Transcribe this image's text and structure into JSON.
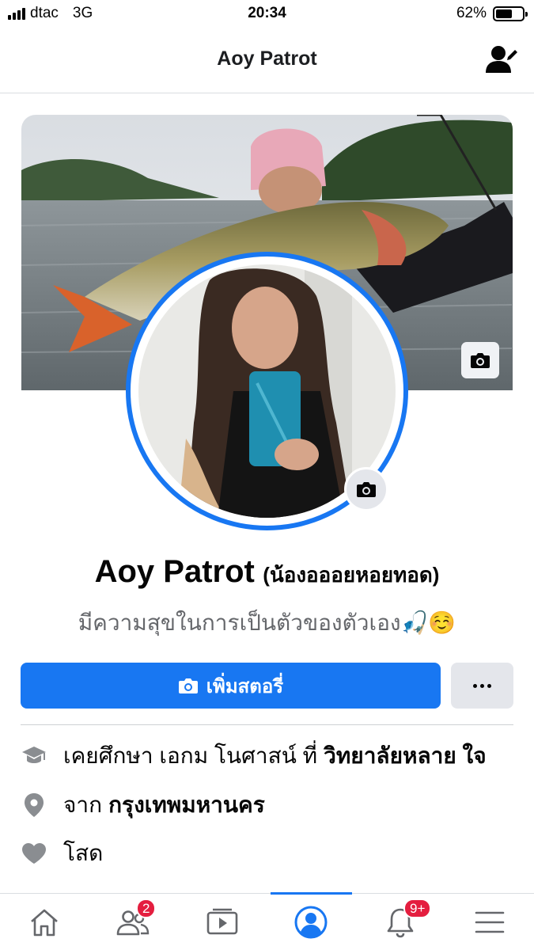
{
  "status_bar": {
    "carrier": "dtac",
    "network": "3G",
    "time": "20:34",
    "battery_percent": "62%",
    "battery_level": 0.62
  },
  "header": {
    "title": "Aoy Patrot",
    "edit_icon": "edit-profile-icon"
  },
  "profile": {
    "name": "Aoy Patrot",
    "nickname": "(น้องอออยหอยทอด)",
    "bio": "มีความสุขในการเป็นตัวของตัวเอง🎣☺️"
  },
  "actions": {
    "add_story_label": "เพิ่มสตอรี่",
    "more_icon": "more-dots-icon"
  },
  "details": [
    {
      "icon": "graduation-cap-icon",
      "text": "เคยศึกษา เอกม โนศาสน์ ที่",
      "bold": "วิทยาลัยหลาย ใจ"
    },
    {
      "icon": "location-pin-icon",
      "text": "จาก",
      "bold": "กรุงเทพมหานคร"
    },
    {
      "icon": "heart-icon",
      "text": "โสด",
      "bold": ""
    }
  ],
  "tabbar": {
    "active": "profile",
    "friends_badge": "2",
    "notifications_badge": "9+"
  },
  "colors": {
    "brand_blue": "#1877f2",
    "badge_red": "#e41e3f",
    "secondary_text": "#65676b",
    "icon_gray": "#65676b"
  }
}
